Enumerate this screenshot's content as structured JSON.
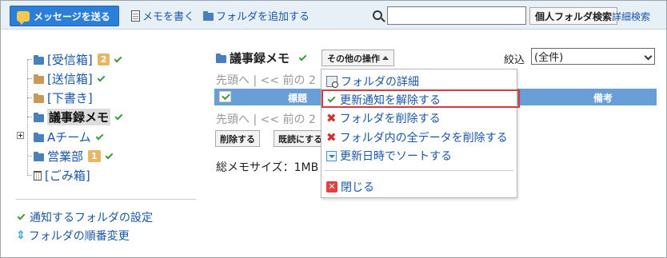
{
  "toolbar": {
    "send_label": "メッセージを送る",
    "write_memo_label": "メモを書く",
    "add_folder_label": "フォルダを追加する",
    "search_value": "",
    "personal_search_label": "個人フォルダ検索",
    "advanced_search_label": "詳細検索"
  },
  "tree": {
    "inbox": {
      "label": "[受信箱]",
      "badge": "2"
    },
    "sent": {
      "label": "[送信箱]"
    },
    "drafts": {
      "label": "[下書き]"
    },
    "minutes": {
      "label": "議事録メモ"
    },
    "team_a": {
      "label": "Aチーム"
    },
    "sales": {
      "label": "営業部",
      "badge": "1"
    },
    "trash": {
      "label": "[ごみ箱]"
    }
  },
  "left_links": {
    "notify_settings": "通知するフォルダの設定",
    "folder_order": "フォルダの順番変更"
  },
  "main": {
    "title": "議事録メモ",
    "ops_label": "その他の操作",
    "filter_label": "絞込",
    "filter_value": "(全件)",
    "pager_top": "先頭へ | << 前の 2",
    "pager_bottom": "先頭へ | << 前の 2",
    "col_title": "標題",
    "col_notes": "備考",
    "delete_button": "削除する",
    "mark_read_button": "既読にする",
    "total_size": "総メモサイズ：1MB"
  },
  "menu": {
    "folder_details": "フォルダの詳細",
    "unsubscribe_updates": "更新通知を解除する",
    "delete_folder": "フォルダを削除する",
    "delete_all_data": "フォルダ内の全データを削除する",
    "sort_by_date": "更新日時でソートする",
    "close": "閉じる"
  },
  "colors": {
    "toolbar_bg": "#e8f0f7",
    "send_button": "#2b7fd8",
    "link": "#1a56a6",
    "table_header": "#6a9ed6",
    "highlight_border": "#d83a3a",
    "badge": "#e8b565"
  }
}
